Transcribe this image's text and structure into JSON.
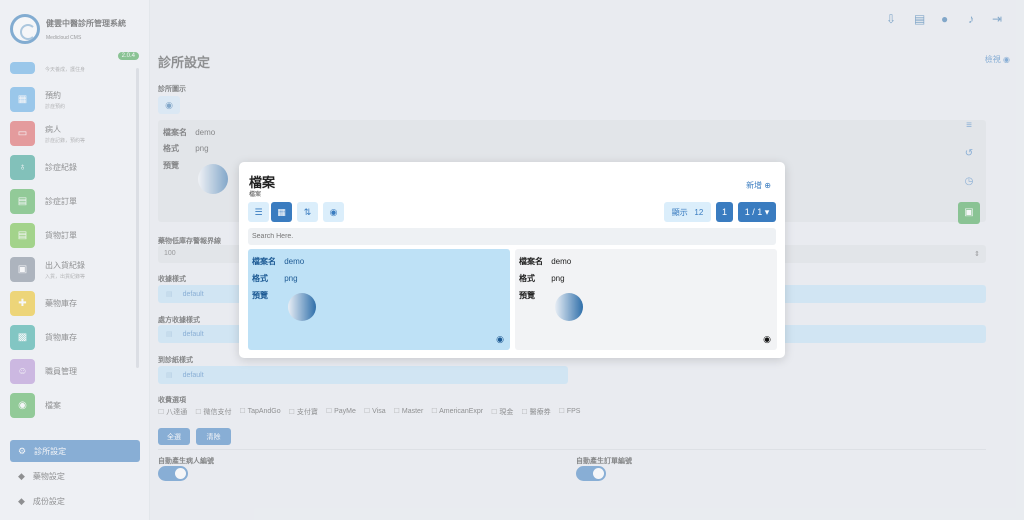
{
  "app": {
    "title": "健雲中醫診所管理系統",
    "subtitle": "Medicloud CMS",
    "version": "2.0.4"
  },
  "sidebar": {
    "items": [
      {
        "label": "",
        "desc": "今天養成，護住身",
        "color": "#5aa9e6",
        "icon": "person-icon"
      },
      {
        "label": "預約",
        "desc": "診症預約",
        "color": "#5aa9e6",
        "icon": "calendar-icon"
      },
      {
        "label": "病人",
        "desc": "診症記錄，預約等",
        "color": "#e05a5a",
        "icon": "id-card-icon"
      },
      {
        "label": "診症紀錄",
        "desc": "",
        "color": "#2f9e8f",
        "icon": "stethoscope-icon"
      },
      {
        "label": "診症訂單",
        "desc": "",
        "color": "#4caf50",
        "icon": "clipboard-icon"
      },
      {
        "label": "貨物訂單",
        "desc": "",
        "color": "#6bbf3a",
        "icon": "document-icon"
      },
      {
        "label": "出入貨紀錄",
        "desc": "入貨，出貨紀錄等",
        "color": "#7d8896",
        "icon": "truck-icon"
      },
      {
        "label": "藥物庫存",
        "desc": "",
        "color": "#f0c419",
        "icon": "medicine-icon"
      },
      {
        "label": "貨物庫存",
        "desc": "",
        "color": "#2fa89e",
        "icon": "boxes-icon"
      },
      {
        "label": "職員管理",
        "desc": "",
        "color": "#b58ed6",
        "icon": "staff-icon"
      },
      {
        "label": "檔案",
        "desc": "",
        "color": "#4caf50",
        "icon": "file-icon"
      }
    ],
    "bottom": [
      {
        "label": "診所設定",
        "active": true
      },
      {
        "label": "藥物設定",
        "active": false
      },
      {
        "label": "成份設定",
        "active": false
      }
    ]
  },
  "topbar": {
    "icons": [
      "download-icon",
      "clipboard-icon",
      "user-icon",
      "bell-icon",
      "logout-icon"
    ]
  },
  "main": {
    "page_title": "診所設定",
    "lang_label": "檢視",
    "clinic_icon_label": "診所圖示",
    "file_panel": {
      "name_label": "檔案名",
      "name_value": "demo",
      "format_label": "格式",
      "format_value": "png",
      "preview_label": "預覽"
    },
    "low_stock_label": "藥物低庫存警報界線",
    "low_stock_value": "100",
    "receipt_style_label": "收據樣式",
    "receipt_style_value": "default",
    "prescription_style_label": "處方收據樣式",
    "prescription_style_value": "default",
    "diagnosis_style_label": "到診紙樣式",
    "diagnosis_style_value": "default",
    "payment_label": "收費選項",
    "payment_options": [
      "八達通",
      "微信支付",
      "TapAndGo",
      "支付寶",
      "PayMe",
      "Visa",
      "Master",
      "AmericanExpr",
      "現金",
      "醫療券",
      "FPS"
    ],
    "select_all": "全選",
    "clear": "清除",
    "auto_patient_label": "自動產生病人編號",
    "auto_order_label": "自動產生訂單編號"
  },
  "modal": {
    "title": "檔案",
    "subtitle": "檔案",
    "add_label": "新增",
    "show_label": "顯示",
    "show_count": "12",
    "page_current": "1",
    "page_total": "1 / 1",
    "search_placeholder": "Search Here.",
    "files": [
      {
        "name_label": "檔案名",
        "name": "demo",
        "format_label": "格式",
        "format": "png",
        "preview_label": "預覽",
        "selected": true
      },
      {
        "name_label": "檔案名",
        "name": "demo",
        "format_label": "格式",
        "format": "png",
        "preview_label": "預覽",
        "selected": false
      }
    ]
  }
}
